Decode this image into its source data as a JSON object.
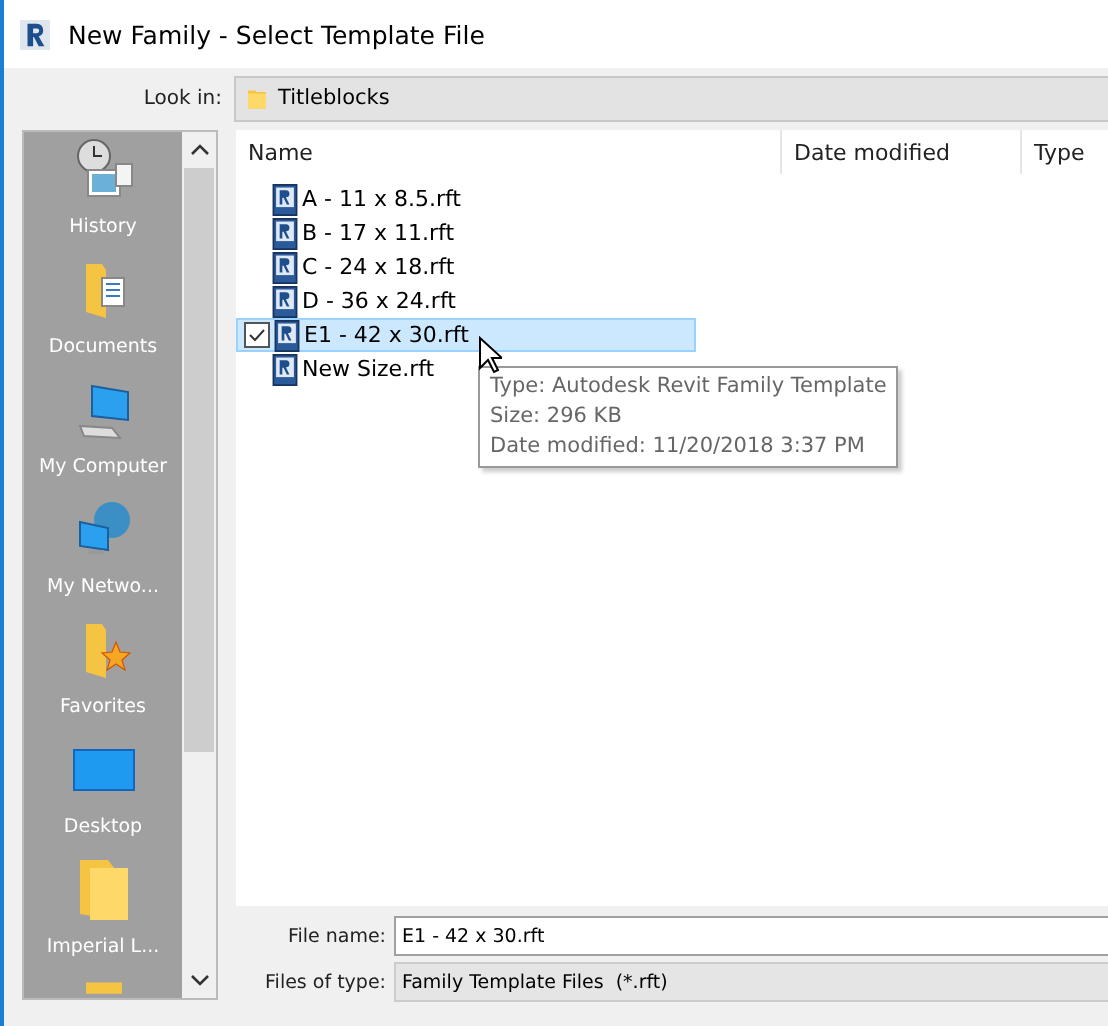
{
  "window": {
    "title": "New Family - Select Template File"
  },
  "look_in": {
    "label": "Look in:",
    "value": "Titleblocks"
  },
  "places": [
    {
      "label": "History",
      "kind": "history"
    },
    {
      "label": "Documents",
      "kind": "documents"
    },
    {
      "label": "My Computer",
      "kind": "computer"
    },
    {
      "label": "My Netwo...",
      "kind": "network"
    },
    {
      "label": "Favorites",
      "kind": "favorites"
    },
    {
      "label": "Desktop",
      "kind": "desktop"
    },
    {
      "label": "Imperial L...",
      "kind": "folder"
    }
  ],
  "columns": [
    "Name",
    "Date modified",
    "Type"
  ],
  "files": [
    {
      "name": "A - 11 x 8.5.rft",
      "selected": false
    },
    {
      "name": "B - 17 x 11.rft",
      "selected": false
    },
    {
      "name": "C - 24 x 18.rft",
      "selected": false
    },
    {
      "name": "D - 36 x 24.rft",
      "selected": false
    },
    {
      "name": "E1 - 42 x 30.rft",
      "selected": true
    },
    {
      "name": "New Size.rft",
      "selected": false
    }
  ],
  "tooltip": [
    "Type: Autodesk Revit Family Template",
    "Size: 296 KB",
    "Date modified: 11/20/2018 3:37 PM"
  ],
  "file_name": {
    "label": "File name:",
    "value": "E1 - 42 x 30.rft"
  },
  "file_type": {
    "label": "Files of type:",
    "value": "Family Template Files  (*.rft)"
  }
}
